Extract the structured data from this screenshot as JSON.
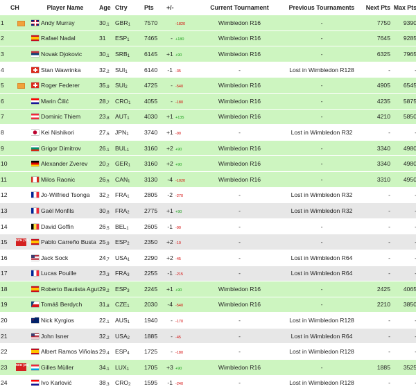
{
  "headers": {
    "rank": "",
    "ch": "CH",
    "name": "Player Name",
    "age": "Age",
    "ctry": "Ctry",
    "pts": "Pts",
    "pm": "+/-",
    "cur": "Current Tournament",
    "prev": "Previous Tournaments",
    "next": "Next Pts",
    "max": "Max Pts"
  },
  "colors": {
    "green_row": "#cdf5c0",
    "grey_row": "#e7e7e7",
    "diff_red": "#d40000",
    "diff_green": "#1a9e1a",
    "badge_orange": "#f1a23a",
    "badge_red": "#d42020"
  },
  "rows": [
    {
      "rank": "1",
      "ch": "orange",
      "name": "Andy Murray",
      "flag": "GBR",
      "age": "30",
      "agesub": "1",
      "ctry": "GBR",
      "ctrysub": "1",
      "pts": "7570",
      "chg": "",
      "diff": "-1820",
      "diffup": false,
      "cur": "Wimbledon R16",
      "prev": "-",
      "next": "7750",
      "max": "9390",
      "style": "green"
    },
    {
      "rank": "2",
      "ch": "",
      "name": "Rafael Nadal",
      "flag": "ESP",
      "age": "31",
      "agesub": "",
      "ctry": "ESP",
      "ctrysub": "1",
      "pts": "7465",
      "chg": "-",
      "diff": "+180",
      "diffup": true,
      "cur": "Wimbledon R16",
      "prev": "-",
      "next": "7645",
      "max": "9285",
      "style": "green"
    },
    {
      "rank": "3",
      "ch": "",
      "name": "Novak Djokovic",
      "flag": "SRB",
      "age": "30",
      "agesub": "1",
      "ctry": "SRB",
      "ctrysub": "1",
      "pts": "6145",
      "chg": "+1",
      "diff": "+90",
      "diffup": true,
      "cur": "Wimbledon R16",
      "prev": "-",
      "next": "6325",
      "max": "7965",
      "style": "green"
    },
    {
      "rank": "4",
      "ch": "",
      "name": "Stan Wawrinka",
      "flag": "SUI",
      "age": "32",
      "agesub": "2",
      "ctry": "SUI",
      "ctrysub": "1",
      "pts": "6140",
      "chg": "-1",
      "diff": "-35",
      "diffup": false,
      "cur": "-",
      "prev": "Lost in Wimbledon R128",
      "next": "-",
      "max": "-",
      "style": "white"
    },
    {
      "rank": "5",
      "ch": "orange",
      "name": "Roger Federer",
      "flag": "SUI",
      "age": "35",
      "agesub": "9",
      "ctry": "SUI",
      "ctrysub": "2",
      "pts": "4725",
      "chg": "-",
      "diff": "-540",
      "diffup": false,
      "cur": "Wimbledon R16",
      "prev": "-",
      "next": "4905",
      "max": "6545",
      "style": "green"
    },
    {
      "rank": "6",
      "ch": "",
      "name": "Marin Čilić",
      "flag": "CRO",
      "age": "28",
      "agesub": "7",
      "ctry": "CRO",
      "ctrysub": "1",
      "pts": "4055",
      "chg": "-",
      "diff": "-180",
      "diffup": false,
      "cur": "Wimbledon R16",
      "prev": "-",
      "next": "4235",
      "max": "5875",
      "style": "green"
    },
    {
      "rank": "7",
      "ch": "",
      "name": "Dominic Thiem",
      "flag": "AUT",
      "age": "23",
      "agesub": "8",
      "ctry": "AUT",
      "ctrysub": "1",
      "pts": "4030",
      "chg": "+1",
      "diff": "+135",
      "diffup": true,
      "cur": "Wimbledon R16",
      "prev": "-",
      "next": "4210",
      "max": "5850",
      "style": "green"
    },
    {
      "rank": "8",
      "ch": "",
      "name": "Kei Nishikori",
      "flag": "JPN",
      "age": "27",
      "agesub": "5",
      "ctry": "JPN",
      "ctrysub": "1",
      "pts": "3740",
      "chg": "+1",
      "diff": "-90",
      "diffup": false,
      "cur": "-",
      "prev": "Lost in Wimbledon R32",
      "next": "-",
      "max": "-",
      "style": "white"
    },
    {
      "rank": "9",
      "ch": "",
      "name": "Grigor Dimitrov",
      "flag": "BUL",
      "age": "26",
      "agesub": "1",
      "ctry": "BUL",
      "ctrysub": "1",
      "pts": "3160",
      "chg": "+2",
      "diff": "+90",
      "diffup": true,
      "cur": "Wimbledon R16",
      "prev": "-",
      "next": "3340",
      "max": "4980",
      "style": "green"
    },
    {
      "rank": "10",
      "ch": "",
      "name": "Alexander Zverev",
      "flag": "GER",
      "age": "20",
      "agesub": "2",
      "ctry": "GER",
      "ctrysub": "1",
      "pts": "3160",
      "chg": "+2",
      "diff": "+90",
      "diffup": true,
      "cur": "Wimbledon R16",
      "prev": "-",
      "next": "3340",
      "max": "4980",
      "style": "green"
    },
    {
      "rank": "11",
      "ch": "",
      "name": "Milos Raonic",
      "flag": "CAN",
      "age": "26",
      "agesub": "5",
      "ctry": "CAN",
      "ctrysub": "1",
      "pts": "3130",
      "chg": "-4",
      "diff": "-1020",
      "diffup": false,
      "cur": "Wimbledon R16",
      "prev": "-",
      "next": "3310",
      "max": "4950",
      "style": "green"
    },
    {
      "rank": "12",
      "ch": "",
      "name": "Jo-Wilfried Tsonga",
      "flag": "FRA",
      "age": "32",
      "agesub": "2",
      "ctry": "FRA",
      "ctrysub": "1",
      "pts": "2805",
      "chg": "-2",
      "diff": "-270",
      "diffup": false,
      "cur": "-",
      "prev": "Lost in Wimbledon R32",
      "next": "-",
      "max": "-",
      "style": "white"
    },
    {
      "rank": "13",
      "ch": "",
      "name": "Gaël Monfils",
      "flag": "FRA",
      "age": "30",
      "agesub": "8",
      "ctry": "FRA",
      "ctrysub": "2",
      "pts": "2775",
      "chg": "+1",
      "diff": "+90",
      "diffup": true,
      "cur": "-",
      "prev": "Lost in Wimbledon R32",
      "next": "-",
      "max": "-",
      "style": "grey"
    },
    {
      "rank": "14",
      "ch": "",
      "name": "David Goffin",
      "flag": "BEL",
      "age": "26",
      "agesub": "5",
      "ctry": "BEL",
      "ctrysub": "1",
      "pts": "2605",
      "chg": "-1",
      "diff": "-90",
      "diffup": false,
      "cur": "-",
      "prev": "-",
      "next": "-",
      "max": "-",
      "style": "white"
    },
    {
      "rank": "15",
      "ch": "red",
      "chtext": "NCH (12)",
      "name": "Pablo Carreño Busta",
      "flag": "ESP",
      "age": "25",
      "agesub": "9",
      "ctry": "ESP",
      "ctrysub": "2",
      "pts": "2350",
      "chg": "+2",
      "diff": "-10",
      "diffup": false,
      "cur": "-",
      "prev": "-",
      "next": "-",
      "max": "-",
      "style": "grey"
    },
    {
      "rank": "16",
      "ch": "",
      "name": "Jack Sock",
      "flag": "USA",
      "age": "24",
      "agesub": "7",
      "ctry": "USA",
      "ctrysub": "1",
      "pts": "2290",
      "chg": "+2",
      "diff": "-45",
      "diffup": false,
      "cur": "-",
      "prev": "Lost in Wimbledon R64",
      "next": "-",
      "max": "-",
      "style": "white"
    },
    {
      "rank": "17",
      "ch": "",
      "name": "Lucas Pouille",
      "flag": "FRA",
      "age": "23",
      "agesub": "3",
      "ctry": "FRA",
      "ctrysub": "3",
      "pts": "2255",
      "chg": "-1",
      "diff": "-215",
      "diffup": false,
      "cur": "-",
      "prev": "Lost in Wimbledon R64",
      "next": "-",
      "max": "-",
      "style": "grey"
    },
    {
      "rank": "18",
      "ch": "",
      "name": "Roberto Bautista Agut",
      "flag": "ESP",
      "age": "29",
      "agesub": "2",
      "ctry": "ESP",
      "ctrysub": "3",
      "pts": "2245",
      "chg": "+1",
      "diff": "+90",
      "diffup": true,
      "cur": "Wimbledon R16",
      "prev": "-",
      "next": "2425",
      "max": "4065",
      "style": "green"
    },
    {
      "rank": "19",
      "ch": "",
      "name": "Tomáš Berdych",
      "flag": "CZE",
      "age": "31",
      "agesub": "8",
      "ctry": "CZE",
      "ctrysub": "1",
      "pts": "2030",
      "chg": "-4",
      "diff": "-540",
      "diffup": false,
      "cur": "Wimbledon R16",
      "prev": "-",
      "next": "2210",
      "max": "3850",
      "style": "green"
    },
    {
      "rank": "20",
      "ch": "",
      "name": "Nick Kyrgios",
      "flag": "AUS",
      "age": "22",
      "agesub": "1",
      "ctry": "AUS",
      "ctrysub": "1",
      "pts": "1940",
      "chg": "-",
      "diff": "-170",
      "diffup": false,
      "cur": "-",
      "prev": "Lost in Wimbledon R128",
      "next": "-",
      "max": "-",
      "style": "white"
    },
    {
      "rank": "21",
      "ch": "",
      "name": "John Isner",
      "flag": "USA",
      "age": "32",
      "agesub": "2",
      "ctry": "USA",
      "ctrysub": "2",
      "pts": "1885",
      "chg": "-",
      "diff": "-45",
      "diffup": false,
      "cur": "-",
      "prev": "Lost in Wimbledon R64",
      "next": "-",
      "max": "-",
      "style": "grey"
    },
    {
      "rank": "22",
      "ch": "",
      "name": "Albert Ramos Viñolas",
      "flag": "ESP",
      "age": "29",
      "agesub": "4",
      "ctry": "ESP",
      "ctrysub": "4",
      "pts": "1725",
      "chg": "-",
      "diff": "-180",
      "diffup": false,
      "cur": "-",
      "prev": "Lost in Wimbledon R128",
      "next": "-",
      "max": "-",
      "style": "white"
    },
    {
      "rank": "23",
      "ch": "red",
      "chtext": "NCH (26)",
      "name": "Gilles Müller",
      "flag": "LUX",
      "age": "34",
      "agesub": "1",
      "ctry": "LUX",
      "ctrysub": "1",
      "pts": "1705",
      "chg": "+3",
      "diff": "+90",
      "diffup": true,
      "cur": "Wimbledon R16",
      "prev": "-",
      "next": "1885",
      "max": "3525",
      "style": "green"
    },
    {
      "rank": "24",
      "ch": "",
      "name": "Ivo Karlović",
      "flag": "CRO",
      "age": "38",
      "agesub": "3",
      "ctry": "CRO",
      "ctrysub": "2",
      "pts": "1595",
      "chg": "-1",
      "diff": "-240",
      "diffup": false,
      "cur": "-",
      "prev": "Lost in Wimbledon R128",
      "next": "-",
      "max": "-",
      "style": "white"
    }
  ]
}
